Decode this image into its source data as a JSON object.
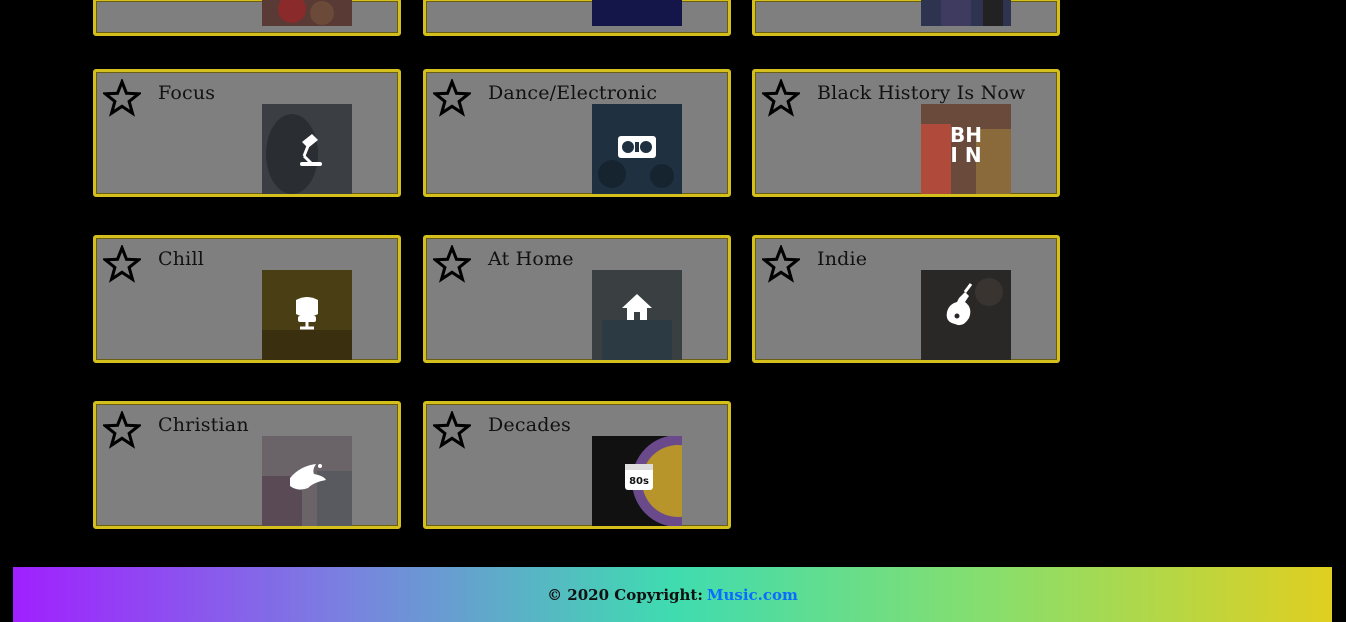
{
  "cards_partial": [
    {
      "id": "p1"
    },
    {
      "id": "p2"
    },
    {
      "id": "p3"
    }
  ],
  "cards": [
    {
      "title": "Focus",
      "icon": "desk-lamp-icon"
    },
    {
      "title": "Dance/Electronic",
      "icon": "turntable-icon"
    },
    {
      "title": "Black History Is Now",
      "icon": "bhin-logo",
      "logo_text": "BH IN"
    },
    {
      "title": "Chill",
      "icon": "armchair-icon"
    },
    {
      "title": "At Home",
      "icon": "house-icon"
    },
    {
      "title": "Indie",
      "icon": "guitar-icon"
    },
    {
      "title": "Christian",
      "icon": "dove-icon"
    },
    {
      "title": "Decades",
      "icon": "calendar-80s-icon",
      "logo_text": "80s"
    }
  ],
  "footer": {
    "prefix": "© 2020 Copyright:",
    "link": "Music.com"
  },
  "colors": {
    "card_bg": "#7f7f7f",
    "card_border": "#d4bf1c",
    "link": "#0a6cff"
  }
}
